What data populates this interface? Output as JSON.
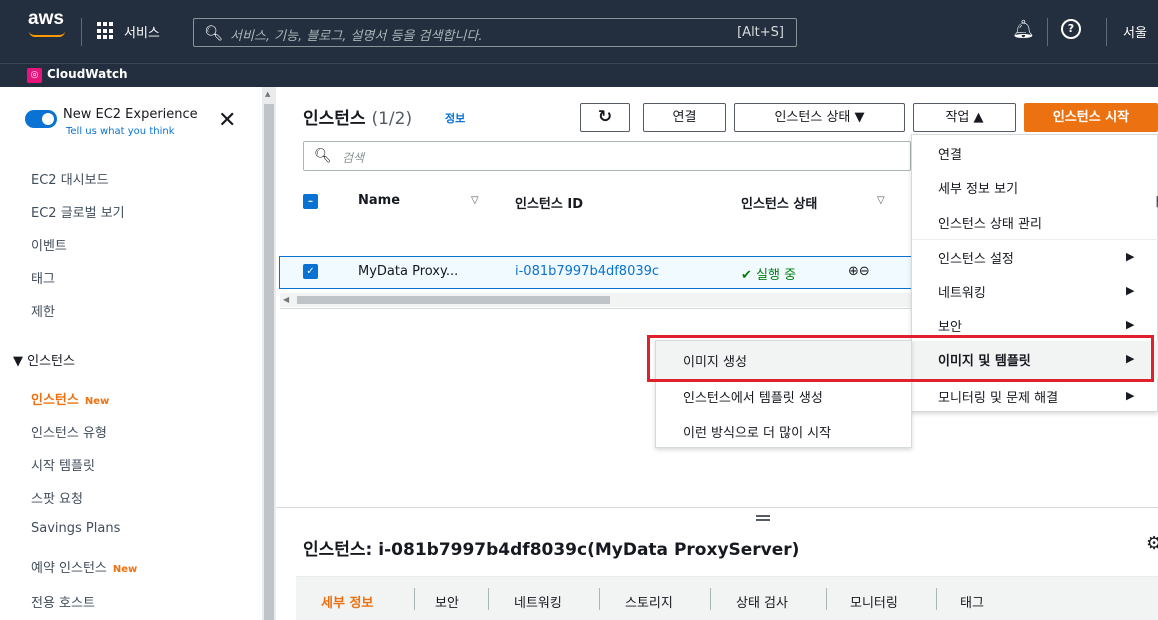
{
  "topbar": {
    "logo": "aws",
    "services_label": "서비스",
    "search_placeholder": "서비스, 기능, 블로그, 설명서 등을 검색합니다.",
    "search_shortcut": "[Alt+S]",
    "region": "서울"
  },
  "favorites": {
    "cloudwatch_label": "CloudWatch"
  },
  "sidebar": {
    "new_exp_title": "New EC2 Experience",
    "new_exp_sub": "Tell us what you think",
    "items": [
      {
        "label": "EC2 대시보드"
      },
      {
        "label": "EC2 글로벌 보기"
      },
      {
        "label": "이벤트"
      },
      {
        "label": "태그"
      },
      {
        "label": "제한"
      }
    ],
    "section_label": "인스턴스",
    "section_items": [
      {
        "label": "인스턴스",
        "badge": "New"
      },
      {
        "label": "인스턴스 유형"
      },
      {
        "label": "시작 템플릿"
      },
      {
        "label": "스팟 요청"
      },
      {
        "label": "Savings Plans"
      },
      {
        "label": "예약 인스턴스",
        "badge": "New"
      },
      {
        "label": "전용 호스트"
      }
    ]
  },
  "main": {
    "title": "인스턴스",
    "count": "(1/2)",
    "info": "정보",
    "buttons": {
      "connect": "연결",
      "instance_state": "인스턴스 상태",
      "actions": "작업",
      "launch": "인스턴스 시작"
    },
    "filter_placeholder": "검색",
    "columns": [
      "Name",
      "인스턴스 ID",
      "인스턴스 상태"
    ],
    "row": {
      "name": "MyData Proxy...",
      "id": "i-081b7997b4df8039c",
      "status": "실행 중"
    }
  },
  "actions_menu": {
    "items": [
      "연결",
      "세부 정보 보기",
      "인스턴스 상태 관리",
      "인스턴스 설정",
      "네트워킹",
      "보안",
      "이미지 및 템플릿",
      "모니터링 및 문제 해결"
    ]
  },
  "submenu": {
    "items": [
      "이미지 생성",
      "인스턴스에서 템플릿 생성",
      "이런 방식으로 더 많이 시작"
    ]
  },
  "details": {
    "title": "인스턴스: i-081b7997b4df8039c(MyData ProxyServer)",
    "tabs": [
      "세부 정보",
      "보안",
      "네트워킹",
      "스토리지",
      "상태 검사",
      "모니터링",
      "태그"
    ]
  }
}
